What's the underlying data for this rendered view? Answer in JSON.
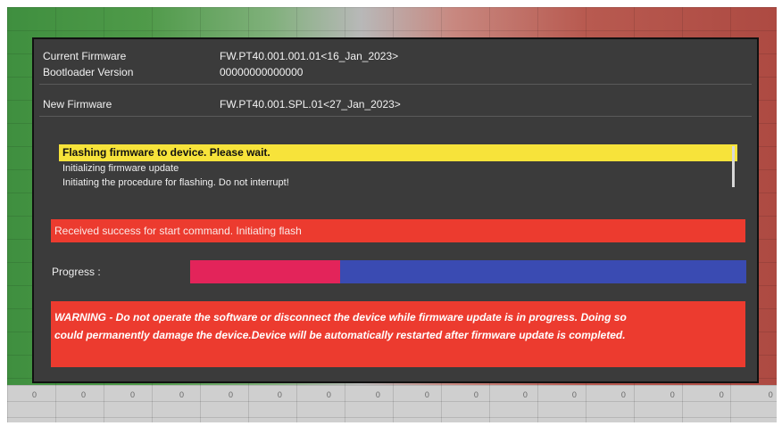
{
  "background": {
    "ticks": [
      "0",
      "0",
      "0",
      "0",
      "0",
      "0",
      "0",
      "0",
      "0",
      "0",
      "0",
      "0",
      "0",
      "0",
      "0",
      "0"
    ]
  },
  "dialog": {
    "current_firmware_label": "Current Firmware",
    "current_firmware_value": "FW.PT40.001.001.01<16_Jan_2023>",
    "bootloader_label": "Bootloader Version",
    "bootloader_value": "00000000000000",
    "new_firmware_label": "New Firmware",
    "new_firmware_value": "FW.PT40.001.SPL.01<27_Jan_2023>",
    "log": {
      "highlight": "Flashing firmware to device. Please wait.",
      "lines": [
        "Initializing firmware update",
        "Initiating the procedure for flashing. Do not interrupt!"
      ]
    },
    "status_message": "Received success for start command. Initiating flash",
    "progress_label": "Progress :",
    "progress_fraction": 0.27,
    "warning_line1": "WARNING - Do not operate the software or disconnect the device while firmware update is in progress. Doing so",
    "warning_line2": "could permanently damage the device.Device will be automatically restarted after firmware update is completed.",
    "colors": {
      "dialog_bg": "#3b3b3b",
      "highlight_bg": "#f7e33a",
      "status_bg": "#ec3b2f",
      "progress_fill": "#e3245a",
      "progress_track": "#3a4bb2"
    }
  }
}
